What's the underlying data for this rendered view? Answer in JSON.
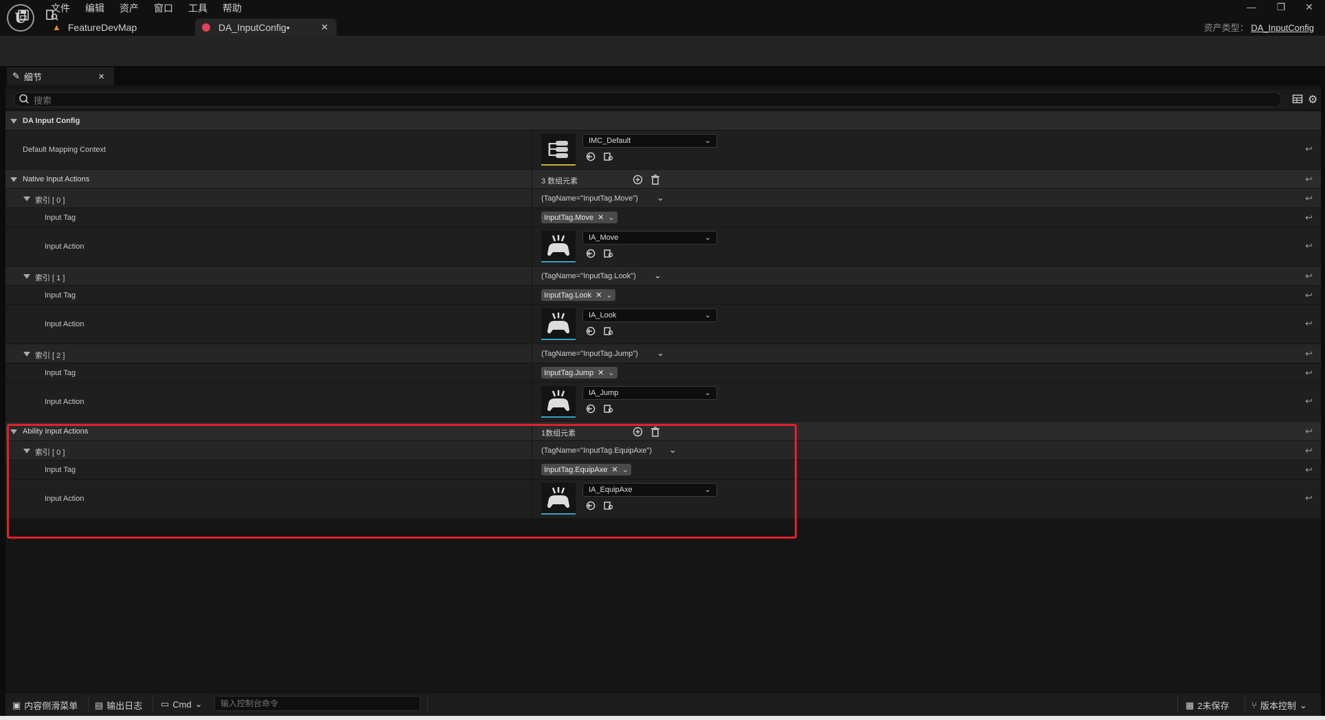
{
  "menu": [
    "文件",
    "编辑",
    "资产",
    "窗口",
    "工具",
    "帮助"
  ],
  "tabs": [
    {
      "label": "FeatureDevMap",
      "active": false
    },
    {
      "label": "DA_InputConfig•",
      "active": true
    }
  ],
  "asset_type": {
    "label": "资产类型：",
    "value": "DA_InputConfig"
  },
  "panel": {
    "title": "细节",
    "close": "×"
  },
  "search": {
    "placeholder": "搜索"
  },
  "rows": {
    "r_cat": {
      "name": "DA Input Config"
    },
    "r_dmc": {
      "name": "Default Mapping Context",
      "asset": "IMC_Default"
    },
    "r_nia": {
      "name": "Native Input Actions",
      "value": "3 数组元素"
    },
    "r_n0": {
      "name": "索引 [ 0 ]",
      "value": "(TagName=\"InputTag.Move\")"
    },
    "r_n0t": {
      "name": "Input Tag",
      "tag": "InputTag.Move"
    },
    "r_n0a": {
      "name": "Input Action",
      "asset": "IA_Move"
    },
    "r_n1": {
      "name": "索引 [ 1 ]",
      "value": "(TagName=\"InputTag.Look\")"
    },
    "r_n1t": {
      "name": "Input Tag",
      "tag": "InputTag.Look"
    },
    "r_n1a": {
      "name": "Input Action",
      "asset": "IA_Look"
    },
    "r_n2": {
      "name": "索引 [ 2 ]",
      "value": "(TagName=\"InputTag.Jump\")"
    },
    "r_n2t": {
      "name": "Input Tag",
      "tag": "InputTag.Jump"
    },
    "r_n2a": {
      "name": "Input Action",
      "asset": "IA_Jump"
    },
    "r_aia": {
      "name": "Ability Input Actions",
      "value": "1数组元素"
    },
    "r_a0": {
      "name": "索引 [ 0 ]",
      "value": "(TagName=\"InputTag.EquipAxe\")"
    },
    "r_a0t": {
      "name": "Input Tag",
      "tag": "InputTag.EquipAxe"
    },
    "r_a0a": {
      "name": "Input Action",
      "asset": "IA_EquipAxe"
    }
  },
  "status": {
    "content_drawer": "内容侧滑菜单",
    "output_log": "输出日志",
    "cmd": "Cmd",
    "console_placeholder": "输入控制台命令",
    "unsaved": "2未保存",
    "source_control": "版本控制"
  },
  "colors": {
    "highlight": "#e0222e",
    "accent": "#3aa0c8",
    "tab_icon": "#e0425a"
  }
}
